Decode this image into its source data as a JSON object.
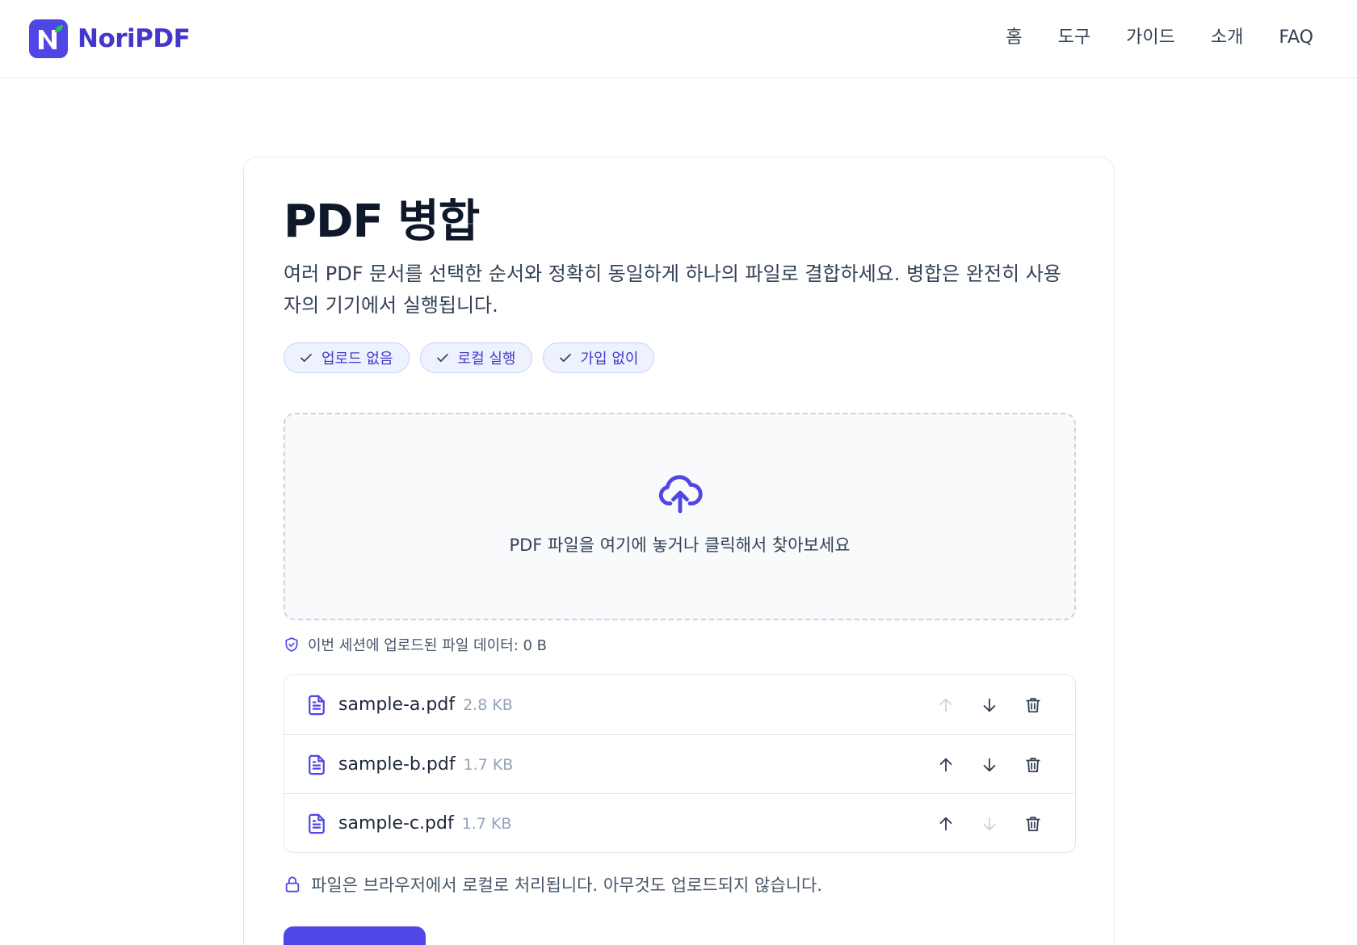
{
  "brand": {
    "name": "NoriPDF",
    "accent": "#4f46e5",
    "leaf": "#22c55e"
  },
  "nav": [
    {
      "label": "홈"
    },
    {
      "label": "도구"
    },
    {
      "label": "가이드"
    },
    {
      "label": "소개"
    },
    {
      "label": "FAQ"
    }
  ],
  "page": {
    "title": "PDF 병합",
    "description": "여러 PDF 문서를 선택한 순서와 정확히 동일하게 하나의 파일로 결합하세요. 병합은 완전히 사용자의 기기에서 실행됩니다."
  },
  "chips": [
    {
      "label": "업로드 없음",
      "icon": "check-icon"
    },
    {
      "label": "로컬 실행",
      "icon": "check-icon"
    },
    {
      "label": "가입 없이",
      "icon": "check-icon"
    }
  ],
  "dropzone": {
    "text": "PDF 파일을 여기에 놓거나 클릭해서 찾아보세요",
    "icon": "cloud-upload-icon"
  },
  "session": {
    "text": "이번 세션에 업로드된 파일 데이터: 0 B",
    "icon": "shield-check-icon"
  },
  "files": [
    {
      "name": "sample-a.pdf",
      "size": "2.8 KB",
      "up_enabled": false,
      "down_enabled": true
    },
    {
      "name": "sample-b.pdf",
      "size": "1.7 KB",
      "up_enabled": true,
      "down_enabled": true
    },
    {
      "name": "sample-c.pdf",
      "size": "1.7 KB",
      "up_enabled": true,
      "down_enabled": false
    }
  ],
  "local_note": {
    "text": "파일은 브라우저에서 로컬로 처리됩니다. 아무것도 업로드되지 않습니다.",
    "icon": "lock-icon"
  },
  "merge_button": {
    "label": ""
  }
}
